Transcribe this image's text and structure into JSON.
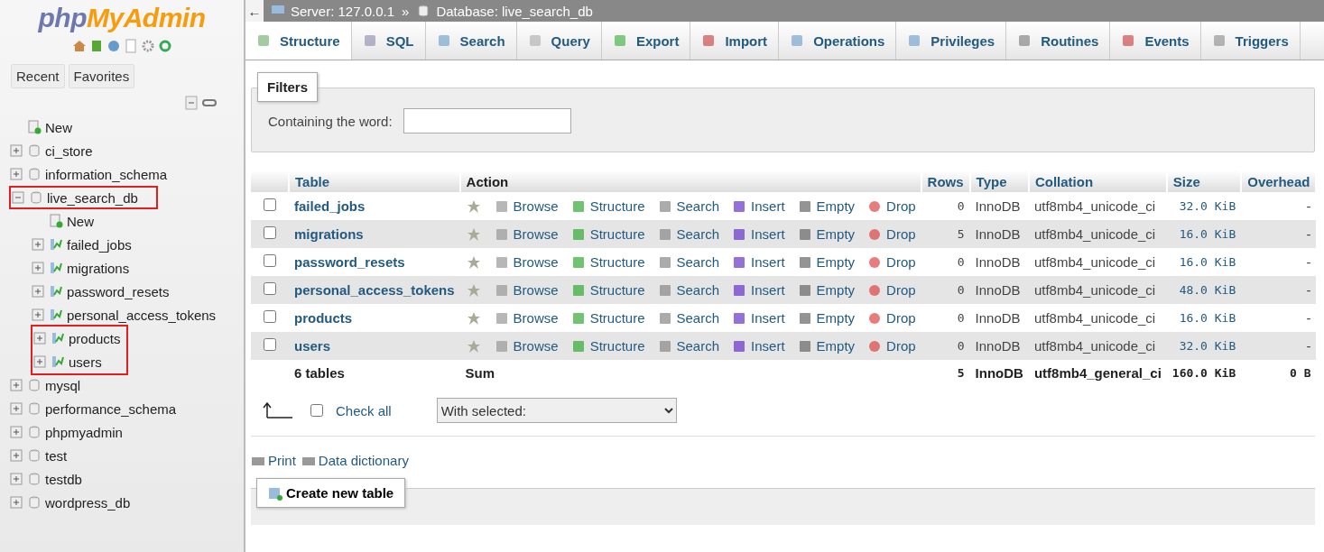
{
  "logo": {
    "part1": "php",
    "part2": "MyAdmin"
  },
  "nav_tabs": [
    {
      "label": "Recent"
    },
    {
      "label": "Favorites"
    }
  ],
  "tree": [
    {
      "label": "New",
      "kind": "new",
      "highlighted": false
    },
    {
      "label": "ci_store",
      "kind": "db",
      "highlighted": false
    },
    {
      "label": "information_schema",
      "kind": "db",
      "highlighted": false
    },
    {
      "label": "live_search_db",
      "kind": "db",
      "highlighted": true,
      "expanded": true,
      "children": [
        {
          "label": "New",
          "kind": "new",
          "highlighted": false
        },
        {
          "label": "failed_jobs",
          "kind": "table",
          "highlighted": false
        },
        {
          "label": "migrations",
          "kind": "table",
          "highlighted": false
        },
        {
          "label": "password_resets",
          "kind": "table",
          "highlighted": false
        },
        {
          "label": "personal_access_tokens",
          "kind": "table",
          "highlighted": false
        },
        {
          "label": "products",
          "kind": "table",
          "highlighted": true
        },
        {
          "label": "users",
          "kind": "table",
          "highlighted": true
        }
      ]
    },
    {
      "label": "mysql",
      "kind": "db",
      "highlighted": false
    },
    {
      "label": "performance_schema",
      "kind": "db",
      "highlighted": false
    },
    {
      "label": "phpmyadmin",
      "kind": "db",
      "highlighted": false
    },
    {
      "label": "test",
      "kind": "db",
      "highlighted": false
    },
    {
      "label": "testdb",
      "kind": "db",
      "highlighted": false
    },
    {
      "label": "wordpress_db",
      "kind": "db",
      "highlighted": false
    }
  ],
  "breadcrumb": {
    "back": "←",
    "server": "Server: 127.0.0.1",
    "separator": "»",
    "database": "Database: live_search_db"
  },
  "tabs": [
    {
      "label": "Structure",
      "selected": true
    },
    {
      "label": "SQL",
      "selected": false
    },
    {
      "label": "Search",
      "selected": false
    },
    {
      "label": "Query",
      "selected": false
    },
    {
      "label": "Export",
      "selected": false
    },
    {
      "label": "Import",
      "selected": false
    },
    {
      "label": "Operations",
      "selected": false
    },
    {
      "label": "Privileges",
      "selected": false
    },
    {
      "label": "Routines",
      "selected": false
    },
    {
      "label": "Events",
      "selected": false
    },
    {
      "label": "Triggers",
      "selected": false
    }
  ],
  "filters": {
    "legend": "Filters",
    "label": "Containing the word:"
  },
  "table": {
    "columns": [
      "Table",
      "Action",
      "Rows",
      "Type",
      "Collation",
      "Size",
      "Overhead"
    ],
    "rows": [
      {
        "name": "failed_jobs",
        "checked": false,
        "actions": [
          "Browse",
          "Structure",
          "Search",
          "Insert",
          "Empty",
          "Drop"
        ],
        "rows": "0",
        "type": "InnoDB",
        "collation": "utf8mb4_unicode_ci",
        "size": "32.0 KiB",
        "overhead": "-"
      },
      {
        "name": "migrations",
        "checked": false,
        "actions": [
          "Browse",
          "Structure",
          "Search",
          "Insert",
          "Empty",
          "Drop"
        ],
        "rows": "5",
        "type": "InnoDB",
        "collation": "utf8mb4_unicode_ci",
        "size": "16.0 KiB",
        "overhead": "-"
      },
      {
        "name": "password_resets",
        "checked": false,
        "actions": [
          "Browse",
          "Structure",
          "Search",
          "Insert",
          "Empty",
          "Drop"
        ],
        "rows": "0",
        "type": "InnoDB",
        "collation": "utf8mb4_unicode_ci",
        "size": "16.0 KiB",
        "overhead": "-"
      },
      {
        "name": "personal_access_tokens",
        "checked": false,
        "actions": [
          "Browse",
          "Structure",
          "Search",
          "Insert",
          "Empty",
          "Drop"
        ],
        "rows": "0",
        "type": "InnoDB",
        "collation": "utf8mb4_unicode_ci",
        "size": "48.0 KiB",
        "overhead": "-"
      },
      {
        "name": "products",
        "checked": false,
        "actions": [
          "Browse",
          "Structure",
          "Search",
          "Insert",
          "Empty",
          "Drop"
        ],
        "rows": "0",
        "type": "InnoDB",
        "collation": "utf8mb4_unicode_ci",
        "size": "16.0 KiB",
        "overhead": "-"
      },
      {
        "name": "users",
        "checked": false,
        "actions": [
          "Browse",
          "Structure",
          "Search",
          "Insert",
          "Empty",
          "Drop"
        ],
        "rows": "0",
        "type": "InnoDB",
        "collation": "utf8mb4_unicode_ci",
        "size": "32.0 KiB",
        "overhead": "-"
      }
    ],
    "footer": {
      "name": "6 tables",
      "action": "Sum",
      "rows": "5",
      "type": "InnoDB",
      "collation": "utf8mb4_general_ci",
      "size": "160.0 KiB",
      "overhead": "0 B"
    }
  },
  "bulk": {
    "check_all": "Check all",
    "checked": false,
    "with_selected": "With selected:"
  },
  "links": [
    {
      "label": "Print"
    },
    {
      "label": "Data dictionary"
    }
  ],
  "create_button": "Create new table"
}
